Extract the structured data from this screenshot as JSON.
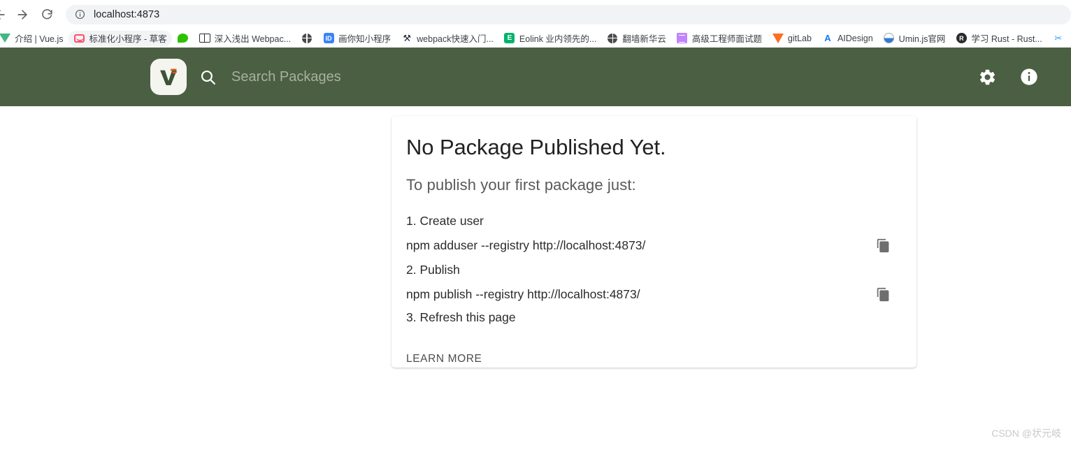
{
  "browser": {
    "back_icon": "back-arrow-icon",
    "forward_icon": "forward-arrow-icon",
    "reload_icon": "reload-icon",
    "site_info_icon": "info-circle-icon",
    "url": "localhost:4873",
    "bookmarks": [
      {
        "label": "介绍 | Vue.js",
        "icon": "vue-icon",
        "icon_class": "fav-vue",
        "hovered": false,
        "icon_only": false,
        "glyph": ""
      },
      {
        "label": "标准化小程序 - 草客",
        "icon": "caoke-icon",
        "icon_class": "fav-caoke",
        "hovered": true,
        "icon_only": false,
        "glyph": ""
      },
      {
        "label": "",
        "icon": "wechat-icon",
        "icon_class": "fav-wechat",
        "hovered": false,
        "icon_only": true,
        "glyph": ""
      },
      {
        "label": "深入浅出 Webpac...",
        "icon": "book-icon",
        "icon_class": "fav-book",
        "hovered": false,
        "icon_only": false,
        "glyph": ""
      },
      {
        "label": "",
        "icon": "globe-icon",
        "icon_class": "fav-globe",
        "hovered": false,
        "icon_only": true,
        "glyph": ""
      },
      {
        "label": "画你知小程序",
        "icon": "huanizhi-icon",
        "icon_class": "fav-blue-sq",
        "hovered": false,
        "icon_only": false,
        "glyph": "ID"
      },
      {
        "label": "webpack快速入门...",
        "icon": "webpack-icon",
        "icon_class": "fav-webpack",
        "hovered": false,
        "icon_only": false,
        "glyph": "⚒"
      },
      {
        "label": "Eolink 业内领先的...",
        "icon": "eolink-icon",
        "icon_class": "fav-eolink",
        "hovered": false,
        "icon_only": false,
        "glyph": "E"
      },
      {
        "label": "翻墙新华云",
        "icon": "globe-icon",
        "icon_class": "fav-globe",
        "hovered": false,
        "icon_only": false,
        "glyph": ""
      },
      {
        "label": "高级工程师面试题",
        "icon": "list-icon",
        "icon_class": "fav-purple-sq",
        "hovered": false,
        "icon_only": false,
        "glyph": ""
      },
      {
        "label": "gitLab",
        "icon": "gitlab-icon",
        "icon_class": "fav-gitlab",
        "hovered": false,
        "icon_only": false,
        "glyph": ""
      },
      {
        "label": "AIDesign",
        "icon": "aidesign-icon",
        "icon_class": "fav-aidesign",
        "hovered": false,
        "icon_only": false,
        "glyph": "A"
      },
      {
        "label": "Umin.js官网",
        "icon": "umi-icon",
        "icon_class": "fav-umi",
        "hovered": false,
        "icon_only": false,
        "glyph": ""
      },
      {
        "label": "学习 Rust - Rust...",
        "icon": "rust-icon",
        "icon_class": "fav-rust",
        "hovered": false,
        "icon_only": false,
        "glyph": "R"
      },
      {
        "label": "",
        "icon": "scissors-icon",
        "icon_class": "fav-cut",
        "hovered": false,
        "icon_only": true,
        "glyph": "✂"
      }
    ]
  },
  "app_header": {
    "brand_color": "#4b6043",
    "logo_icon": "verdaccio-logo-icon",
    "search_icon": "search-icon",
    "search_placeholder": "Search Packages",
    "search_value": "",
    "settings_icon": "gear-icon",
    "info_icon": "info-icon"
  },
  "card": {
    "title": "No Package Published Yet.",
    "subtitle": "To publish your first package just:",
    "steps": [
      {
        "text": "1. Create user",
        "copyable": false
      },
      {
        "text": "npm adduser --registry http://localhost:4873/",
        "copyable": true
      },
      {
        "text": "2. Publish",
        "copyable": false
      },
      {
        "text": "npm publish --registry http://localhost:4873/",
        "copyable": true
      },
      {
        "text": "3. Refresh this page",
        "copyable": false
      }
    ],
    "copy_icon": "copy-icon",
    "learn_more_label": "LEARN MORE"
  },
  "watermark": "CSDN @状元岐"
}
